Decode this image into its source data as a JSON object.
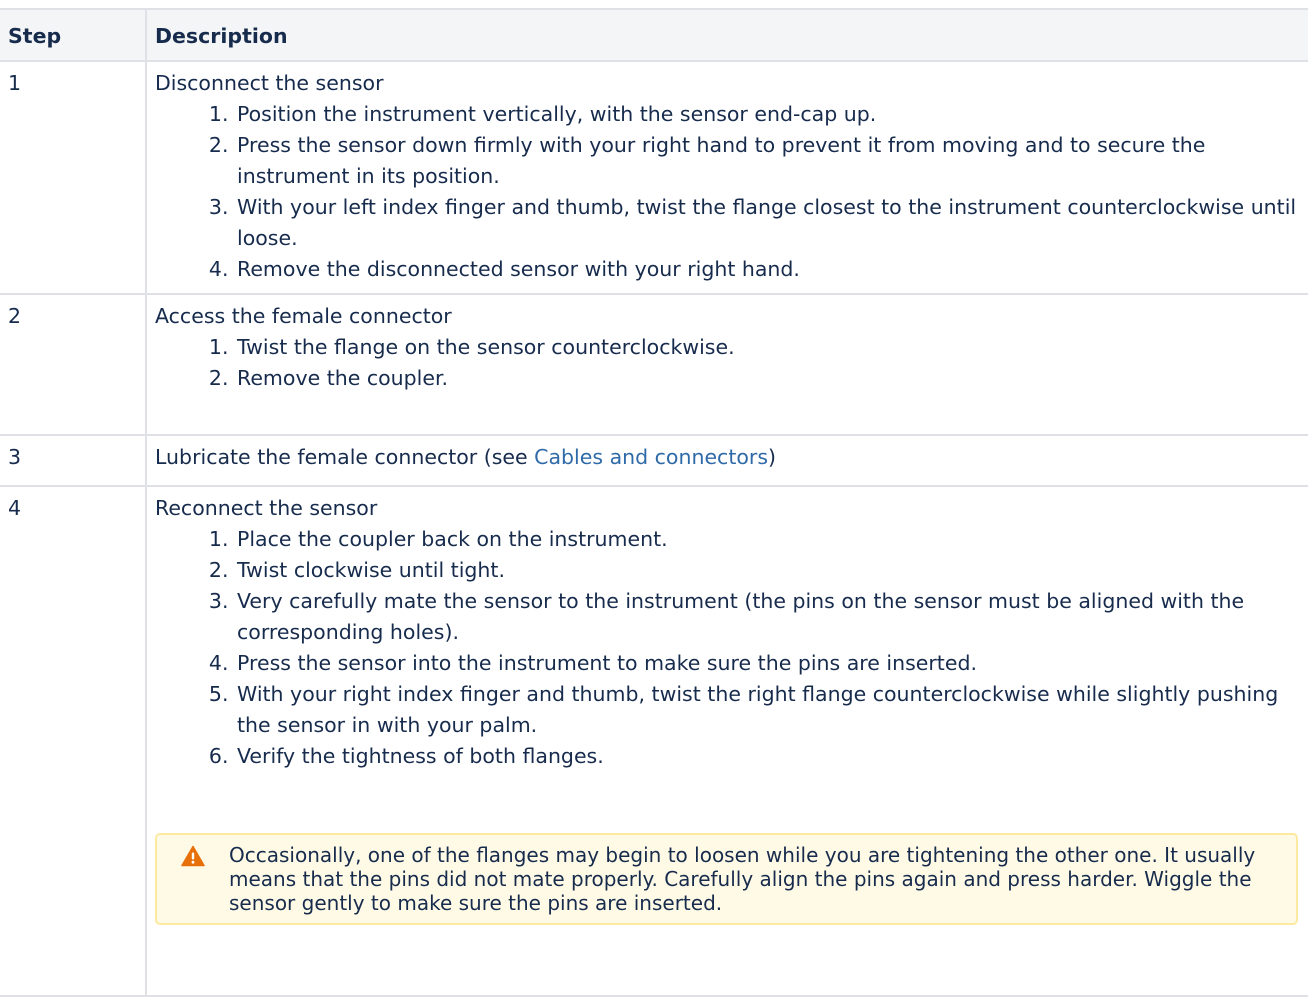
{
  "table": {
    "headers": [
      "Step",
      "Description"
    ],
    "rows": [
      {
        "step": "1",
        "title": "Disconnect the sensor",
        "items": [
          "Position the instrument vertically, with the sensor end-cap up.",
          "Press the sensor down firmly with your right hand to prevent it from moving and to secure the instrument in its position.",
          "With your left index finger and thumb, twist the flange closest to the instrument counterclockwise until loose.",
          "Remove the disconnected sensor with your right hand."
        ]
      },
      {
        "step": "2",
        "title": "Access the female connector",
        "items": [
          "Twist the flange on the sensor counterclockwise.",
          "Remove the coupler."
        ]
      },
      {
        "step": "3",
        "title_prefix": "Lubricate the female connector (see ",
        "link_text": "Cables and connectors",
        "title_suffix": ")"
      },
      {
        "step": "4",
        "title": "Reconnect the sensor",
        "items": [
          "Place the coupler back on the instrument.",
          "Twist clockwise until tight.",
          "Very carefully mate the sensor to the instrument (the pins on the sensor must be aligned with the corresponding holes).",
          "Press the sensor into the instrument to make sure the pins are inserted.",
          "With your right index finger and thumb, twist the right flange counterclockwise while slightly pushing the sensor in with your palm.",
          "Verify the tightness of both flanges."
        ],
        "warning": "Occasionally, one of the flanges may begin to loosen while you are tightening the other one. It usually means that the pins did not mate properly. Carefully align the pins again and press harder. Wiggle the sensor gently to make sure the pins are inserted."
      }
    ]
  },
  "icons": {
    "warning": "warning-icon"
  },
  "colors": {
    "link": "#2f6aa8",
    "warning_icon": "#e8700a",
    "warning_bg": "#fffae6",
    "warning_border": "#fdeaa0",
    "header_bg": "#f4f5f7",
    "border": "#dfe1e6"
  }
}
